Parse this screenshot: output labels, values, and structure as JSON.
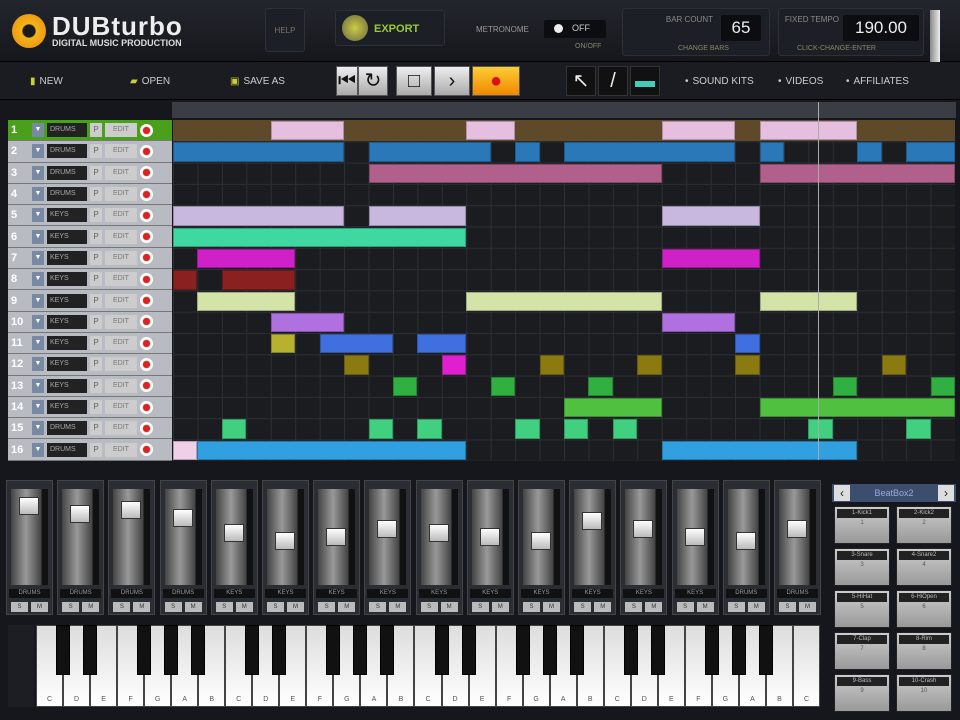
{
  "header": {
    "logo_main": "DUBturbo",
    "logo_sub": "DIGITAL MUSIC PRODUCTION",
    "help": "HELP",
    "export": "EXPORT",
    "metronome": "METRONOME",
    "metronome_state": "OFF",
    "onoff": "ON/OFF",
    "bar_count_label": "BAR COUNT",
    "bar_count": "65",
    "change_bars": "CHANGE BARS",
    "tempo_label": "FIXED TEMPO",
    "tempo": "190.00",
    "tempo_hint": "CLICK-CHANGE-ENTER"
  },
  "toolbar": {
    "new": "NEW",
    "open": "OPEN",
    "save_as": "SAVE AS",
    "sound_kits": "SOUND KITS",
    "videos": "VIDEOS",
    "affiliates": "AFFILIATES"
  },
  "tracks": [
    {
      "n": "1",
      "name": "DRUMS"
    },
    {
      "n": "2",
      "name": "DRUMS"
    },
    {
      "n": "3",
      "name": "DRUMS"
    },
    {
      "n": "4",
      "name": "DRUMS"
    },
    {
      "n": "5",
      "name": "KEYS"
    },
    {
      "n": "6",
      "name": "KEYS"
    },
    {
      "n": "7",
      "name": "KEYS"
    },
    {
      "n": "8",
      "name": "KEYS"
    },
    {
      "n": "9",
      "name": "KEYS"
    },
    {
      "n": "10",
      "name": "KEYS"
    },
    {
      "n": "11",
      "name": "KEYS"
    },
    {
      "n": "12",
      "name": "KEYS"
    },
    {
      "n": "13",
      "name": "KEYS"
    },
    {
      "n": "14",
      "name": "KEYS"
    },
    {
      "n": "15",
      "name": "DRUMS"
    },
    {
      "n": "16",
      "name": "DRUMS"
    }
  ],
  "track_p": "P",
  "track_edit": "EDIT",
  "notes": [
    [
      0,
      4,
      3,
      "#e6bfe0"
    ],
    [
      0,
      12,
      2,
      "#e6bfe0"
    ],
    [
      0,
      20,
      3,
      "#e6bfe0"
    ],
    [
      0,
      24,
      4,
      "#e6bfe0"
    ],
    [
      1,
      0,
      7,
      "#2b78b8"
    ],
    [
      1,
      8,
      5,
      "#2b78b8"
    ],
    [
      1,
      14,
      1,
      "#2b78b8"
    ],
    [
      1,
      16,
      7,
      "#2b78b8"
    ],
    [
      1,
      24,
      1,
      "#2b78b8"
    ],
    [
      1,
      28,
      1,
      "#2b78b8"
    ],
    [
      1,
      30,
      2,
      "#2b78b8"
    ],
    [
      2,
      8,
      12,
      "#b0608a"
    ],
    [
      2,
      24,
      8,
      "#b0608a"
    ],
    [
      4,
      0,
      7,
      "#c8b8e0"
    ],
    [
      4,
      8,
      4,
      "#c8b8e0"
    ],
    [
      4,
      20,
      4,
      "#c8b8e0"
    ],
    [
      5,
      0,
      12,
      "#3ed8a0"
    ],
    [
      6,
      1,
      4,
      "#d020c8"
    ],
    [
      6,
      20,
      4,
      "#d020c8"
    ],
    [
      7,
      0,
      1,
      "#8a2020"
    ],
    [
      7,
      2,
      3,
      "#8a2020"
    ],
    [
      8,
      1,
      4,
      "#d4e4a8"
    ],
    [
      8,
      12,
      8,
      "#d4e4a8"
    ],
    [
      8,
      24,
      4,
      "#d4e4a8"
    ],
    [
      9,
      4,
      3,
      "#b070e0"
    ],
    [
      9,
      20,
      3,
      "#b070e0"
    ],
    [
      10,
      4,
      1,
      "#b8b030"
    ],
    [
      10,
      6,
      3,
      "#4070e0"
    ],
    [
      10,
      10,
      2,
      "#4070e0"
    ],
    [
      10,
      23,
      1,
      "#4070e0"
    ],
    [
      11,
      7,
      1,
      "#8a7a10"
    ],
    [
      11,
      11,
      1,
      "#e020d0"
    ],
    [
      11,
      15,
      1,
      "#8a7a10"
    ],
    [
      11,
      19,
      1,
      "#8a7a10"
    ],
    [
      11,
      23,
      1,
      "#8a7a10"
    ],
    [
      11,
      29,
      1,
      "#8a7a10"
    ],
    [
      12,
      9,
      1,
      "#30b040"
    ],
    [
      12,
      13,
      1,
      "#30b040"
    ],
    [
      12,
      17,
      1,
      "#30b040"
    ],
    [
      12,
      27,
      1,
      "#30b040"
    ],
    [
      12,
      31,
      1,
      "#30b040"
    ],
    [
      13,
      16,
      4,
      "#50c040"
    ],
    [
      13,
      24,
      8,
      "#50c040"
    ],
    [
      14,
      2,
      1,
      "#40d080"
    ],
    [
      14,
      8,
      1,
      "#40d080"
    ],
    [
      14,
      10,
      1,
      "#40d080"
    ],
    [
      14,
      14,
      1,
      "#40d080"
    ],
    [
      14,
      16,
      1,
      "#40d080"
    ],
    [
      14,
      18,
      1,
      "#40d080"
    ],
    [
      14,
      26,
      1,
      "#40d080"
    ],
    [
      14,
      30,
      1,
      "#40d080"
    ],
    [
      15,
      0,
      1,
      "#f0d0e8"
    ],
    [
      15,
      1,
      11,
      "#30a0e0"
    ],
    [
      15,
      20,
      8,
      "#30a0e0"
    ]
  ],
  "mixer": {
    "channels": [
      "DRUMS",
      "DRUMS",
      "DRUMS",
      "DRUMS",
      "KEYS",
      "KEYS",
      "KEYS",
      "KEYS",
      "KEYS",
      "KEYS",
      "KEYS",
      "KEYS",
      "KEYS",
      "KEYS",
      "DRUMS",
      "DRUMS"
    ],
    "fader_levels": [
      0.9,
      0.8,
      0.85,
      0.75,
      0.55,
      0.45,
      0.5,
      0.6,
      0.55,
      0.5,
      0.45,
      0.7,
      0.6,
      0.5,
      0.45,
      0.6
    ],
    "solo": "S",
    "mute": "M"
  },
  "piano": {
    "white_keys": [
      "C",
      "D",
      "E",
      "F",
      "G",
      "A",
      "B",
      "C",
      "D",
      "E",
      "F",
      "G",
      "A",
      "B",
      "C",
      "D",
      "E",
      "F",
      "G",
      "A",
      "B",
      "C",
      "D",
      "E",
      "F",
      "G",
      "A",
      "B",
      "C"
    ]
  },
  "pads": {
    "kit": "BeatBox2",
    "items": [
      {
        "label": "1-Kick1",
        "n": "1"
      },
      {
        "label": "2-Kick2",
        "n": "2"
      },
      {
        "label": "3-Snare",
        "n": "3"
      },
      {
        "label": "4-Snare2",
        "n": "4"
      },
      {
        "label": "5-HiHat",
        "n": "5"
      },
      {
        "label": "6-HiOpen",
        "n": "6"
      },
      {
        "label": "7-Clap",
        "n": "7"
      },
      {
        "label": "8-Rim",
        "n": "8"
      },
      {
        "label": "9-Bass",
        "n": "9"
      },
      {
        "label": "10-Crash",
        "n": "10"
      }
    ]
  }
}
